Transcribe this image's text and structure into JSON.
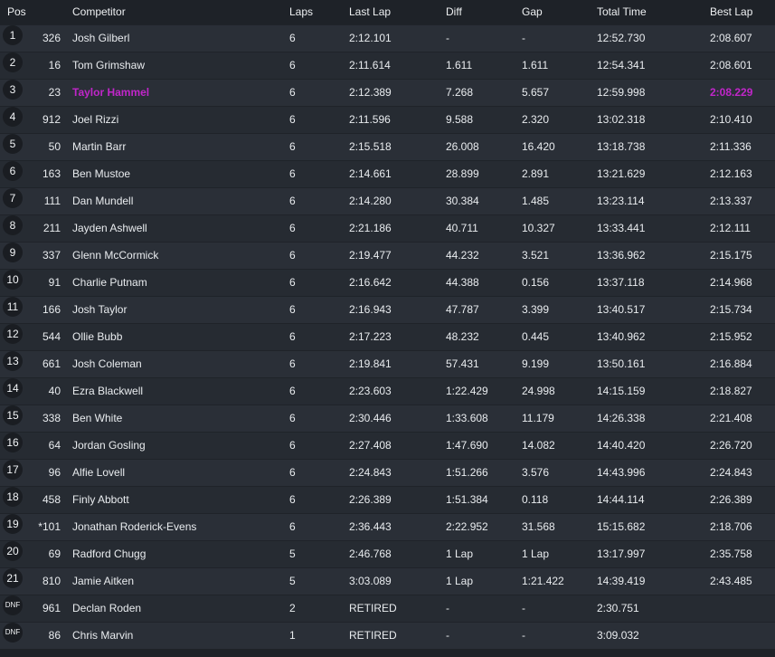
{
  "headers": {
    "pos": "Pos",
    "competitor": "Competitor",
    "laps": "Laps",
    "last_lap": "Last Lap",
    "diff": "Diff",
    "gap": "Gap",
    "total_time": "Total Time",
    "best_lap": "Best Lap"
  },
  "highlight_color": "#c026c9",
  "rows": [
    {
      "pos": "1",
      "num": "326",
      "name": "Josh Gilberl",
      "laps": "6",
      "last": "2:12.101",
      "diff": "-",
      "gap": "-",
      "total": "12:52.730",
      "best": "2:08.607"
    },
    {
      "pos": "2",
      "num": "16",
      "name": "Tom Grimshaw",
      "laps": "6",
      "last": "2:11.614",
      "diff": "1.611",
      "gap": "1.611",
      "total": "12:54.341",
      "best": "2:08.601"
    },
    {
      "pos": "3",
      "num": "23",
      "name": "Taylor Hammel",
      "laps": "6",
      "last": "2:12.389",
      "diff": "7.268",
      "gap": "5.657",
      "total": "12:59.998",
      "best": "2:08.229",
      "highlight": true
    },
    {
      "pos": "4",
      "num": "912",
      "name": "Joel Rizzi",
      "laps": "6",
      "last": "2:11.596",
      "diff": "9.588",
      "gap": "2.320",
      "total": "13:02.318",
      "best": "2:10.410"
    },
    {
      "pos": "5",
      "num": "50",
      "name": "Martin Barr",
      "laps": "6",
      "last": "2:15.518",
      "diff": "26.008",
      "gap": "16.420",
      "total": "13:18.738",
      "best": "2:11.336"
    },
    {
      "pos": "6",
      "num": "163",
      "name": "Ben Mustoe",
      "laps": "6",
      "last": "2:14.661",
      "diff": "28.899",
      "gap": "2.891",
      "total": "13:21.629",
      "best": "2:12.163"
    },
    {
      "pos": "7",
      "num": "111",
      "name": "Dan Mundell",
      "laps": "6",
      "last": "2:14.280",
      "diff": "30.384",
      "gap": "1.485",
      "total": "13:23.114",
      "best": "2:13.337"
    },
    {
      "pos": "8",
      "num": "211",
      "name": "Jayden Ashwell",
      "laps": "6",
      "last": "2:21.186",
      "diff": "40.711",
      "gap": "10.327",
      "total": "13:33.441",
      "best": "2:12.111"
    },
    {
      "pos": "9",
      "num": "337",
      "name": "Glenn McCormick",
      "laps": "6",
      "last": "2:19.477",
      "diff": "44.232",
      "gap": "3.521",
      "total": "13:36.962",
      "best": "2:15.175"
    },
    {
      "pos": "10",
      "num": "91",
      "name": "Charlie Putnam",
      "laps": "6",
      "last": "2:16.642",
      "diff": "44.388",
      "gap": "0.156",
      "total": "13:37.118",
      "best": "2:14.968"
    },
    {
      "pos": "11",
      "num": "166",
      "name": "Josh Taylor",
      "laps": "6",
      "last": "2:16.943",
      "diff": "47.787",
      "gap": "3.399",
      "total": "13:40.517",
      "best": "2:15.734"
    },
    {
      "pos": "12",
      "num": "544",
      "name": "Ollie Bubb",
      "laps": "6",
      "last": "2:17.223",
      "diff": "48.232",
      "gap": "0.445",
      "total": "13:40.962",
      "best": "2:15.952"
    },
    {
      "pos": "13",
      "num": "661",
      "name": "Josh Coleman",
      "laps": "6",
      "last": "2:19.841",
      "diff": "57.431",
      "gap": "9.199",
      "total": "13:50.161",
      "best": "2:16.884"
    },
    {
      "pos": "14",
      "num": "40",
      "name": "Ezra Blackwell",
      "laps": "6",
      "last": "2:23.603",
      "diff": "1:22.429",
      "gap": "24.998",
      "total": "14:15.159",
      "best": "2:18.827"
    },
    {
      "pos": "15",
      "num": "338",
      "name": "Ben White",
      "laps": "6",
      "last": "2:30.446",
      "diff": "1:33.608",
      "gap": "11.179",
      "total": "14:26.338",
      "best": "2:21.408"
    },
    {
      "pos": "16",
      "num": "64",
      "name": "Jordan Gosling",
      "laps": "6",
      "last": "2:27.408",
      "diff": "1:47.690",
      "gap": "14.082",
      "total": "14:40.420",
      "best": "2:26.720"
    },
    {
      "pos": "17",
      "num": "96",
      "name": "Alfie Lovell",
      "laps": "6",
      "last": "2:24.843",
      "diff": "1:51.266",
      "gap": "3.576",
      "total": "14:43.996",
      "best": "2:24.843"
    },
    {
      "pos": "18",
      "num": "458",
      "name": "Finly Abbott",
      "laps": "6",
      "last": "2:26.389",
      "diff": "1:51.384",
      "gap": "0.118",
      "total": "14:44.114",
      "best": "2:26.389"
    },
    {
      "pos": "19",
      "num": "*101",
      "name": "Jonathan Roderick-Evens",
      "laps": "6",
      "last": "2:36.443",
      "diff": "2:22.952",
      "gap": "31.568",
      "total": "15:15.682",
      "best": "2:18.706"
    },
    {
      "pos": "20",
      "num": "69",
      "name": "Radford Chugg",
      "laps": "5",
      "last": "2:46.768",
      "diff": "1 Lap",
      "gap": "1 Lap",
      "total": "13:17.997",
      "best": "2:35.758"
    },
    {
      "pos": "21",
      "num": "810",
      "name": "Jamie Aitken",
      "laps": "5",
      "last": "3:03.089",
      "diff": "1 Lap",
      "gap": "1:21.422",
      "total": "14:39.419",
      "best": "2:43.485"
    },
    {
      "pos": "DNF",
      "num": "961",
      "name": "Declan Roden",
      "laps": "2",
      "last": "RETIRED",
      "diff": "-",
      "gap": "-",
      "total": "2:30.751",
      "best": ""
    },
    {
      "pos": "DNF",
      "num": "86",
      "name": "Chris Marvin",
      "laps": "1",
      "last": "RETIRED",
      "diff": "-",
      "gap": "-",
      "total": "3:09.032",
      "best": ""
    }
  ]
}
